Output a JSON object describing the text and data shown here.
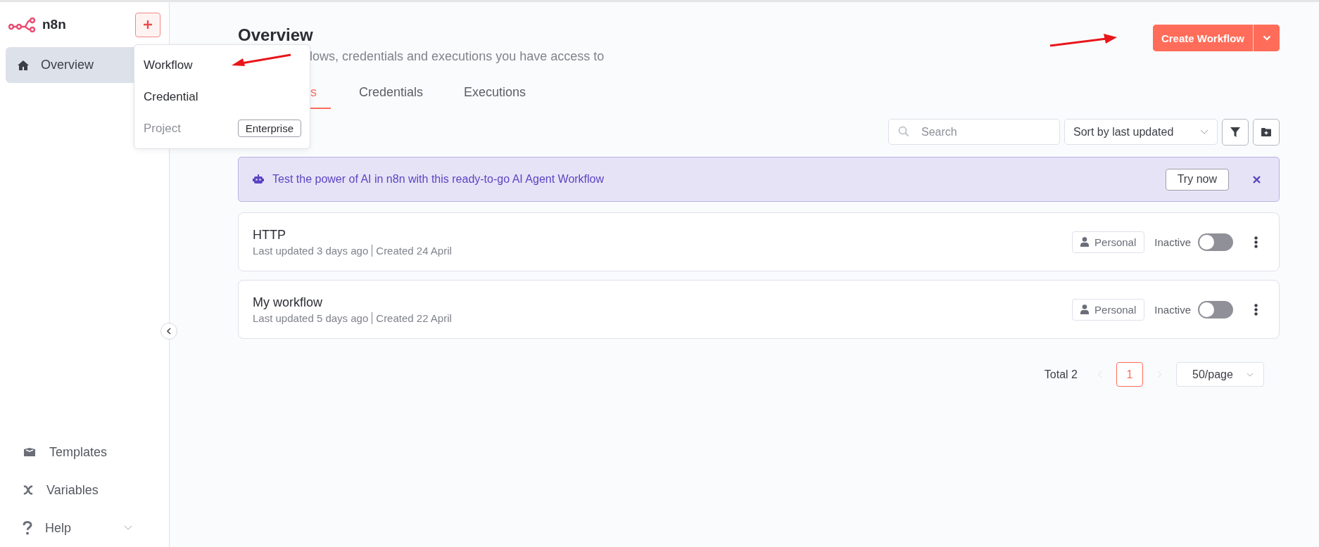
{
  "sidebar": {
    "logo_text": "n8n",
    "items": [
      {
        "label": "Overview",
        "kind": "home",
        "selected": true
      }
    ],
    "bottom_items": [
      {
        "label": "Templates",
        "kind": "templates",
        "expandable": false
      },
      {
        "label": "Variables",
        "kind": "variables",
        "expandable": false
      },
      {
        "label": "Help",
        "kind": "help",
        "expandable": true
      }
    ]
  },
  "create_menu": {
    "items": [
      {
        "label": "Workflow",
        "disabled": false
      },
      {
        "label": "Credential",
        "disabled": false
      },
      {
        "label": "Project",
        "disabled": true,
        "badge": "Enterprise"
      }
    ]
  },
  "header": {
    "title": "Overview",
    "subtitle": "lows, credentials and executions you have access to",
    "create_button": "Create Workflow"
  },
  "tabs": [
    {
      "label": "s",
      "selected": true
    },
    {
      "label": "Credentials",
      "selected": false
    },
    {
      "label": "Executions",
      "selected": false
    }
  ],
  "toolbar": {
    "search": {
      "placeholder": "Search"
    },
    "sort": "Sort by last updated"
  },
  "banner": {
    "text": "Test the power of AI in n8n with this ready-to-go AI Agent Workflow",
    "button": "Try now"
  },
  "workflows": [
    {
      "name": "HTTP",
      "updated": "Last updated 3 days ago",
      "created": "Created 24 April",
      "owner": "Personal",
      "status": "Inactive",
      "on": false
    },
    {
      "name": "My workflow",
      "updated": "Last updated 5 days ago",
      "created": "Created 22 April",
      "owner": "Personal",
      "status": "Inactive",
      "on": false
    }
  ],
  "pagination": {
    "total": "Total 2",
    "pages": [
      {
        "label": "1",
        "selected": true
      }
    ],
    "page_size": "50/page"
  }
}
